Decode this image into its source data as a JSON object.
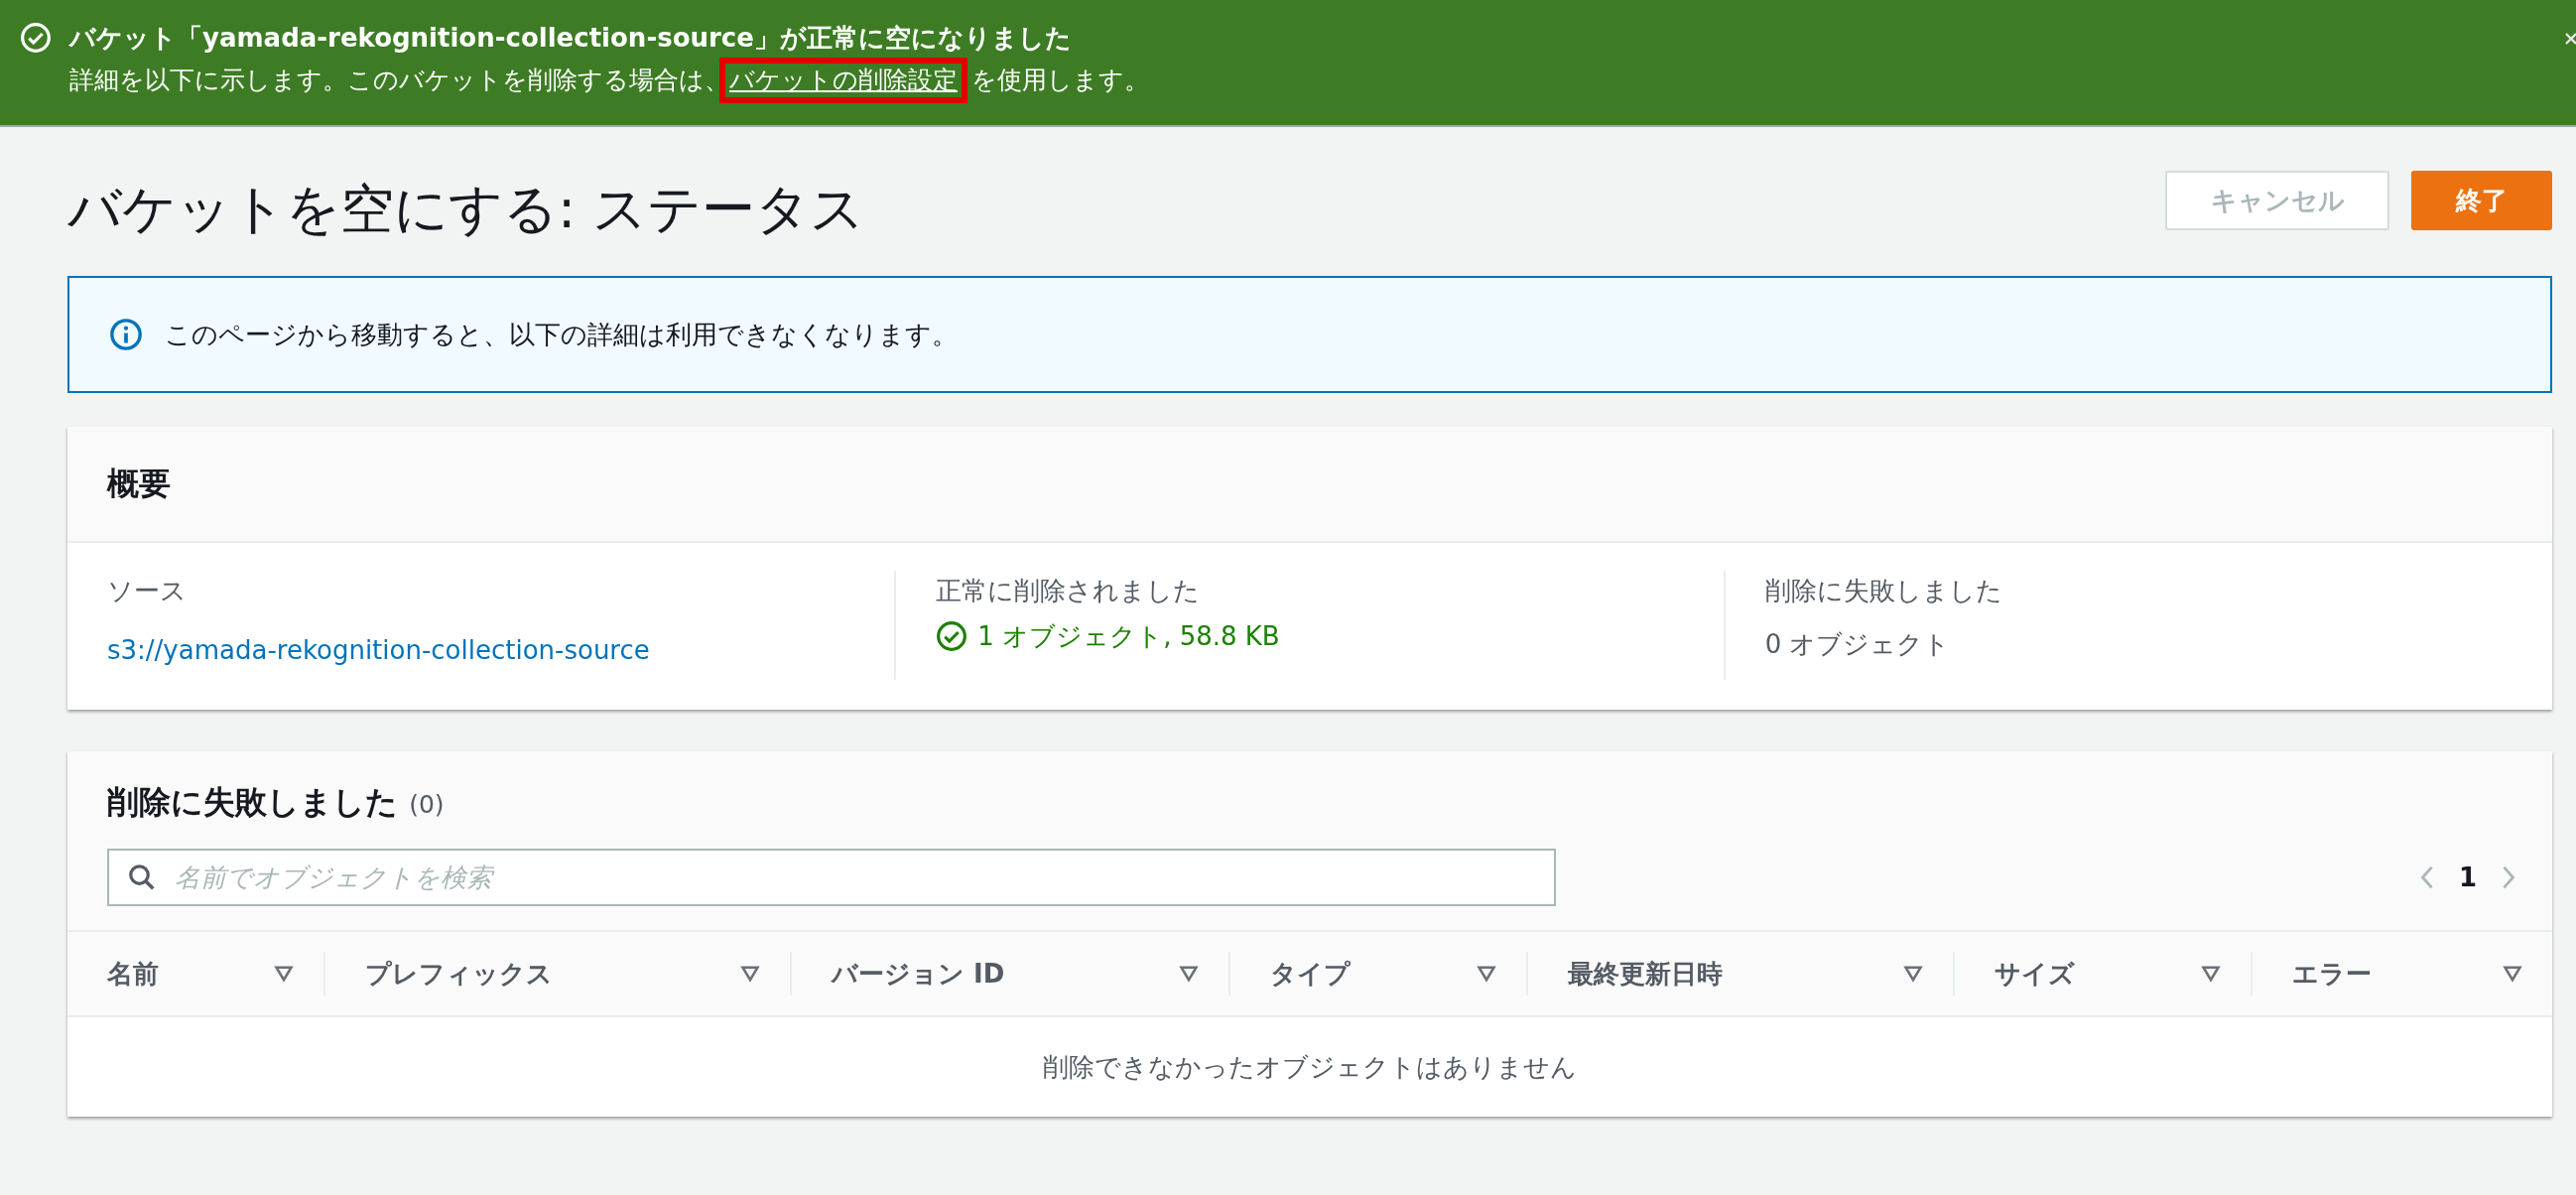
{
  "banner": {
    "title": "バケット「yamada-rekognition-collection-source」が正常に空になりました",
    "message_before": "詳細を以下に示します。このバケットを削除する場合は、",
    "link": "バケットの削除設定",
    "message_after": "を使用します。",
    "highlighted": true
  },
  "page": {
    "title": "バケットを空にする: ステータス",
    "buttons": [
      {
        "label": "キャンセル",
        "kind": "secondary"
      },
      {
        "label": "終了",
        "kind": "primary"
      }
    ]
  },
  "info": {
    "text": "このページから移動すると、以下の詳細は利用できなくなります。"
  },
  "summary": {
    "title": "概要",
    "columns": [
      {
        "label": "ソース",
        "value": "s3://yamada-rekognition-collection-source",
        "kind": "link"
      },
      {
        "label": "正常に削除されました",
        "value": "1 オブジェクト, 58.8 KB",
        "kind": "success"
      },
      {
        "label": "削除に失敗しました",
        "value": "0 オブジェクト",
        "kind": "plain"
      }
    ]
  },
  "failed": {
    "title": "削除に失敗しました",
    "count": "(0)",
    "search": {
      "placeholder": "名前でオブジェクトを検索"
    },
    "pagination": {
      "pages": [
        {
          "label": "1",
          "selected": true
        }
      ]
    },
    "table": {
      "columns": [
        "名前",
        "プレフィックス",
        "バージョン ID",
        "タイプ",
        "最終更新日時",
        "サイズ",
        "エラー"
      ],
      "empty": "削除できなかったオブジェクトはありません"
    }
  }
}
